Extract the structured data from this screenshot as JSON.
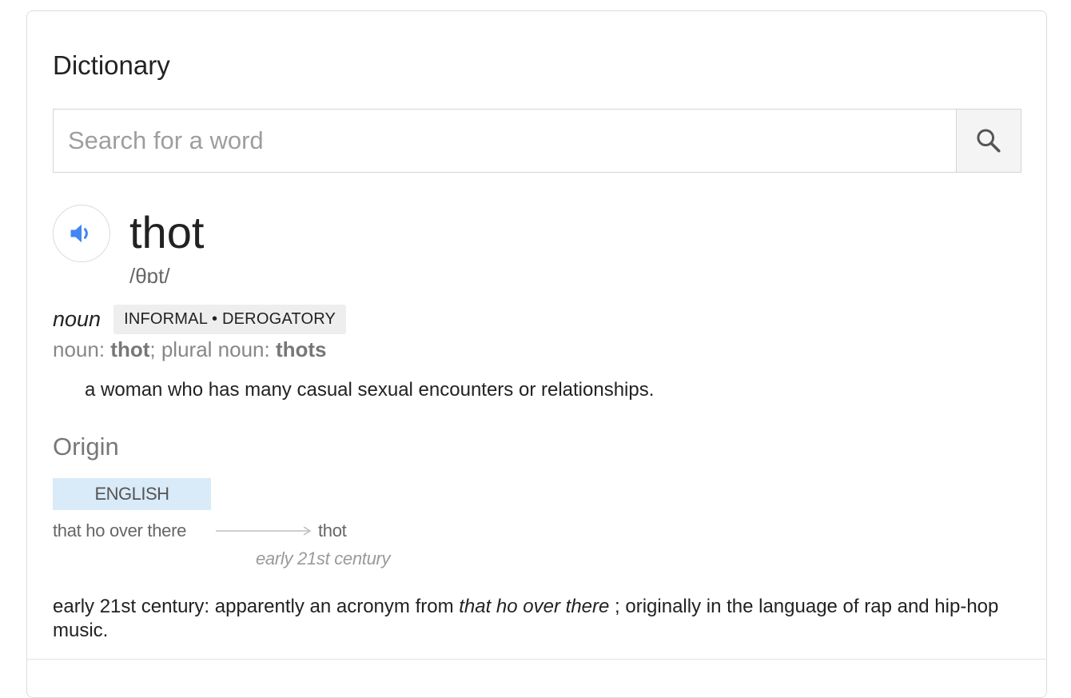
{
  "header": {
    "title": "Dictionary"
  },
  "search": {
    "placeholder": "Search for a word",
    "value": ""
  },
  "entry": {
    "word": "thot",
    "phonetic": "/θɒt/",
    "part_of_speech": "noun",
    "register_tag": "INFORMAL • DEROGATORY",
    "forms": {
      "noun_label": "noun: ",
      "noun_value": "thot",
      "separator": "; ",
      "plural_label": "plural noun: ",
      "plural_value": "thots"
    },
    "definition": "a woman who has many casual sexual encounters or relationships."
  },
  "origin": {
    "title": "Origin",
    "language": "ENGLISH",
    "source_phrase": "that ho over there",
    "target_word": "thot",
    "date": "early 21st century",
    "text_prefix": "early 21st century: apparently an acronym from ",
    "text_italic": "that ho over there",
    "text_suffix": " ; originally in the language of rap and hip-hop music."
  },
  "colors": {
    "speaker_icon": "#4285f4",
    "language_band": "#d9eaf8",
    "tag_background": "#eeeeee"
  },
  "icons": {
    "search": "search-icon",
    "speaker": "speaker-icon",
    "arrow": "arrow-right-icon"
  }
}
